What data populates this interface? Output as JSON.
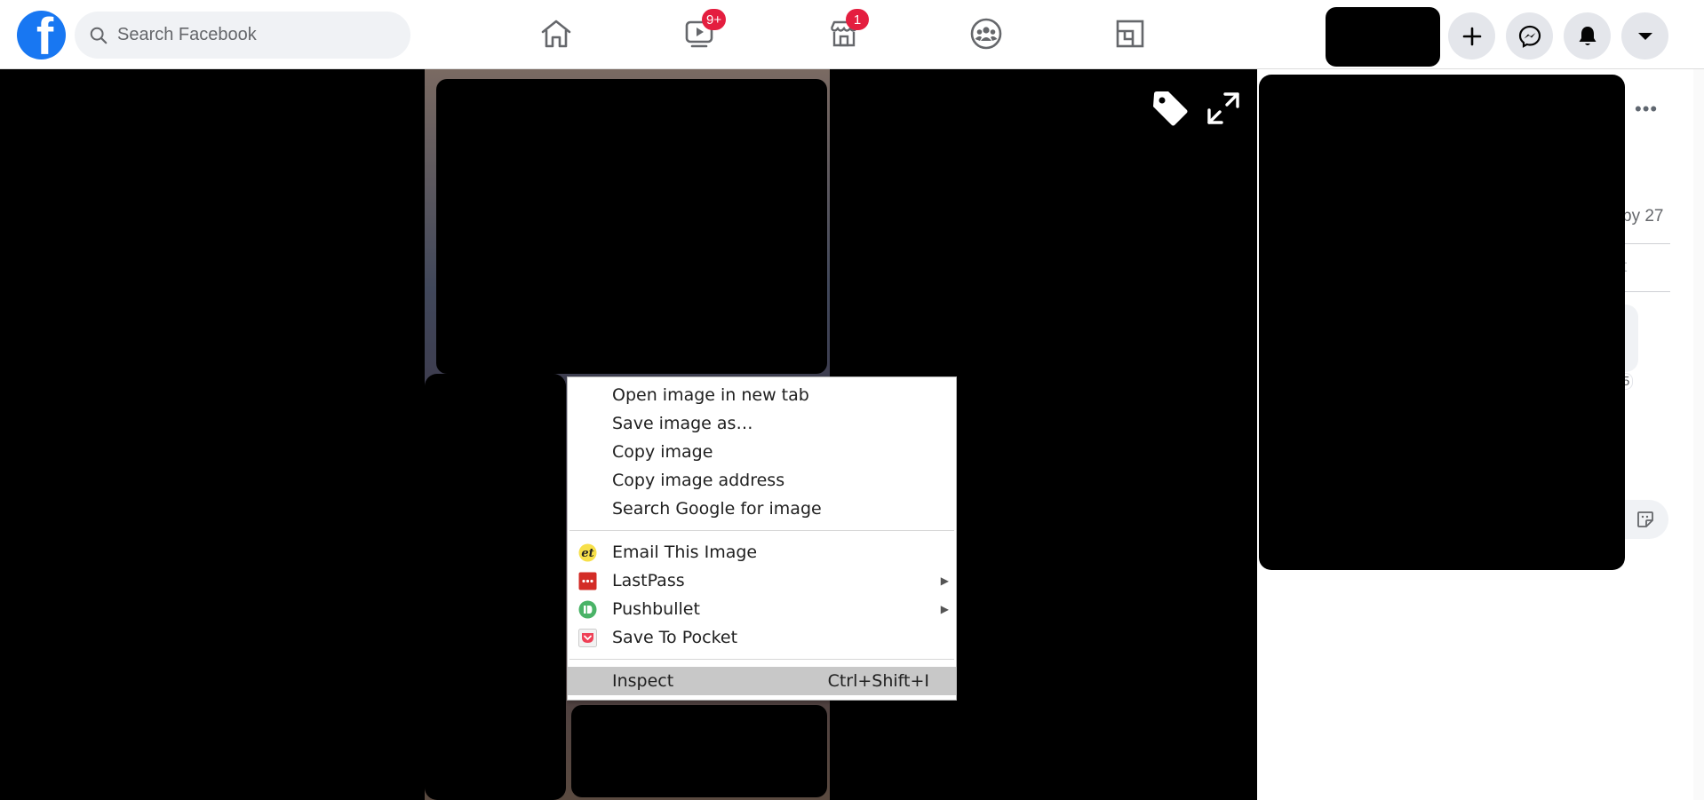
{
  "header": {
    "logo_letter": "f",
    "search_placeholder": "Search Facebook",
    "nav": [
      {
        "name": "home",
        "badge": ""
      },
      {
        "name": "watch",
        "badge": "9+"
      },
      {
        "name": "marketplace",
        "badge": "1"
      },
      {
        "name": "groups",
        "badge": ""
      },
      {
        "name": "gaming",
        "badge": ""
      }
    ]
  },
  "viewer": {
    "tag_icon": "tag-icon",
    "expand_icon": "expand-icon"
  },
  "right_panel": {
    "more_label": "•••",
    "partial_reaction_text": "by 27",
    "partial_action_text": "t",
    "partial_count": "5"
  },
  "context_menu": {
    "group1": [
      {
        "label": "Open image in new tab"
      },
      {
        "label": "Save image as…"
      },
      {
        "label": "Copy image"
      },
      {
        "label": "Copy image address"
      },
      {
        "label": "Search Google for image"
      }
    ],
    "group2": [
      {
        "label": "Email This Image",
        "icon": "email-this-icon",
        "submenu": false
      },
      {
        "label": "LastPass",
        "icon": "lastpass-icon",
        "submenu": true
      },
      {
        "label": "Pushbullet",
        "icon": "pushbullet-icon",
        "submenu": true
      },
      {
        "label": "Save To Pocket",
        "icon": "pocket-icon",
        "submenu": false
      }
    ],
    "group3": [
      {
        "label": "Inspect",
        "shortcut": "Ctrl+Shift+I",
        "selected": true
      }
    ],
    "submenu_arrow": "▶"
  },
  "colors": {
    "brand": "#1877f2",
    "badge": "#e41e3f"
  }
}
